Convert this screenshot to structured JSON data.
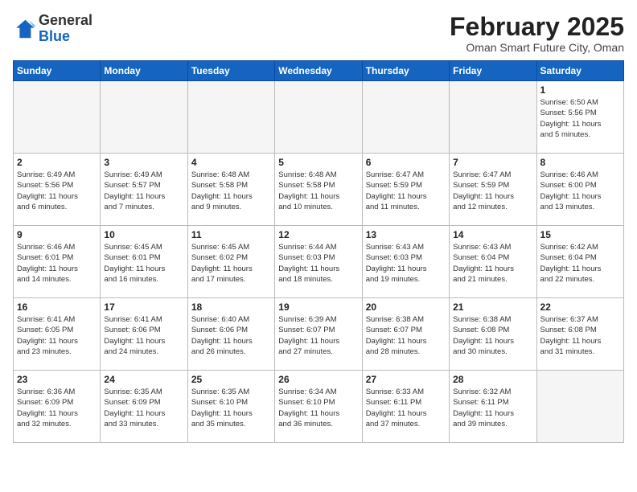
{
  "header": {
    "logo": {
      "general": "General",
      "blue": "Blue"
    },
    "title": "February 2025",
    "subtitle": "Oman Smart Future City, Oman"
  },
  "days_of_week": [
    "Sunday",
    "Monday",
    "Tuesday",
    "Wednesday",
    "Thursday",
    "Friday",
    "Saturday"
  ],
  "weeks": [
    [
      {
        "day": "",
        "info": ""
      },
      {
        "day": "",
        "info": ""
      },
      {
        "day": "",
        "info": ""
      },
      {
        "day": "",
        "info": ""
      },
      {
        "day": "",
        "info": ""
      },
      {
        "day": "",
        "info": ""
      },
      {
        "day": "1",
        "info": "Sunrise: 6:50 AM\nSunset: 5:56 PM\nDaylight: 11 hours\nand 5 minutes."
      }
    ],
    [
      {
        "day": "2",
        "info": "Sunrise: 6:49 AM\nSunset: 5:56 PM\nDaylight: 11 hours\nand 6 minutes."
      },
      {
        "day": "3",
        "info": "Sunrise: 6:49 AM\nSunset: 5:57 PM\nDaylight: 11 hours\nand 7 minutes."
      },
      {
        "day": "4",
        "info": "Sunrise: 6:48 AM\nSunset: 5:58 PM\nDaylight: 11 hours\nand 9 minutes."
      },
      {
        "day": "5",
        "info": "Sunrise: 6:48 AM\nSunset: 5:58 PM\nDaylight: 11 hours\nand 10 minutes."
      },
      {
        "day": "6",
        "info": "Sunrise: 6:47 AM\nSunset: 5:59 PM\nDaylight: 11 hours\nand 11 minutes."
      },
      {
        "day": "7",
        "info": "Sunrise: 6:47 AM\nSunset: 5:59 PM\nDaylight: 11 hours\nand 12 minutes."
      },
      {
        "day": "8",
        "info": "Sunrise: 6:46 AM\nSunset: 6:00 PM\nDaylight: 11 hours\nand 13 minutes."
      }
    ],
    [
      {
        "day": "9",
        "info": "Sunrise: 6:46 AM\nSunset: 6:01 PM\nDaylight: 11 hours\nand 14 minutes."
      },
      {
        "day": "10",
        "info": "Sunrise: 6:45 AM\nSunset: 6:01 PM\nDaylight: 11 hours\nand 16 minutes."
      },
      {
        "day": "11",
        "info": "Sunrise: 6:45 AM\nSunset: 6:02 PM\nDaylight: 11 hours\nand 17 minutes."
      },
      {
        "day": "12",
        "info": "Sunrise: 6:44 AM\nSunset: 6:03 PM\nDaylight: 11 hours\nand 18 minutes."
      },
      {
        "day": "13",
        "info": "Sunrise: 6:43 AM\nSunset: 6:03 PM\nDaylight: 11 hours\nand 19 minutes."
      },
      {
        "day": "14",
        "info": "Sunrise: 6:43 AM\nSunset: 6:04 PM\nDaylight: 11 hours\nand 21 minutes."
      },
      {
        "day": "15",
        "info": "Sunrise: 6:42 AM\nSunset: 6:04 PM\nDaylight: 11 hours\nand 22 minutes."
      }
    ],
    [
      {
        "day": "16",
        "info": "Sunrise: 6:41 AM\nSunset: 6:05 PM\nDaylight: 11 hours\nand 23 minutes."
      },
      {
        "day": "17",
        "info": "Sunrise: 6:41 AM\nSunset: 6:06 PM\nDaylight: 11 hours\nand 24 minutes."
      },
      {
        "day": "18",
        "info": "Sunrise: 6:40 AM\nSunset: 6:06 PM\nDaylight: 11 hours\nand 26 minutes."
      },
      {
        "day": "19",
        "info": "Sunrise: 6:39 AM\nSunset: 6:07 PM\nDaylight: 11 hours\nand 27 minutes."
      },
      {
        "day": "20",
        "info": "Sunrise: 6:38 AM\nSunset: 6:07 PM\nDaylight: 11 hours\nand 28 minutes."
      },
      {
        "day": "21",
        "info": "Sunrise: 6:38 AM\nSunset: 6:08 PM\nDaylight: 11 hours\nand 30 minutes."
      },
      {
        "day": "22",
        "info": "Sunrise: 6:37 AM\nSunset: 6:08 PM\nDaylight: 11 hours\nand 31 minutes."
      }
    ],
    [
      {
        "day": "23",
        "info": "Sunrise: 6:36 AM\nSunset: 6:09 PM\nDaylight: 11 hours\nand 32 minutes."
      },
      {
        "day": "24",
        "info": "Sunrise: 6:35 AM\nSunset: 6:09 PM\nDaylight: 11 hours\nand 33 minutes."
      },
      {
        "day": "25",
        "info": "Sunrise: 6:35 AM\nSunset: 6:10 PM\nDaylight: 11 hours\nand 35 minutes."
      },
      {
        "day": "26",
        "info": "Sunrise: 6:34 AM\nSunset: 6:10 PM\nDaylight: 11 hours\nand 36 minutes."
      },
      {
        "day": "27",
        "info": "Sunrise: 6:33 AM\nSunset: 6:11 PM\nDaylight: 11 hours\nand 37 minutes."
      },
      {
        "day": "28",
        "info": "Sunrise: 6:32 AM\nSunset: 6:11 PM\nDaylight: 11 hours\nand 39 minutes."
      },
      {
        "day": "",
        "info": ""
      }
    ]
  ]
}
